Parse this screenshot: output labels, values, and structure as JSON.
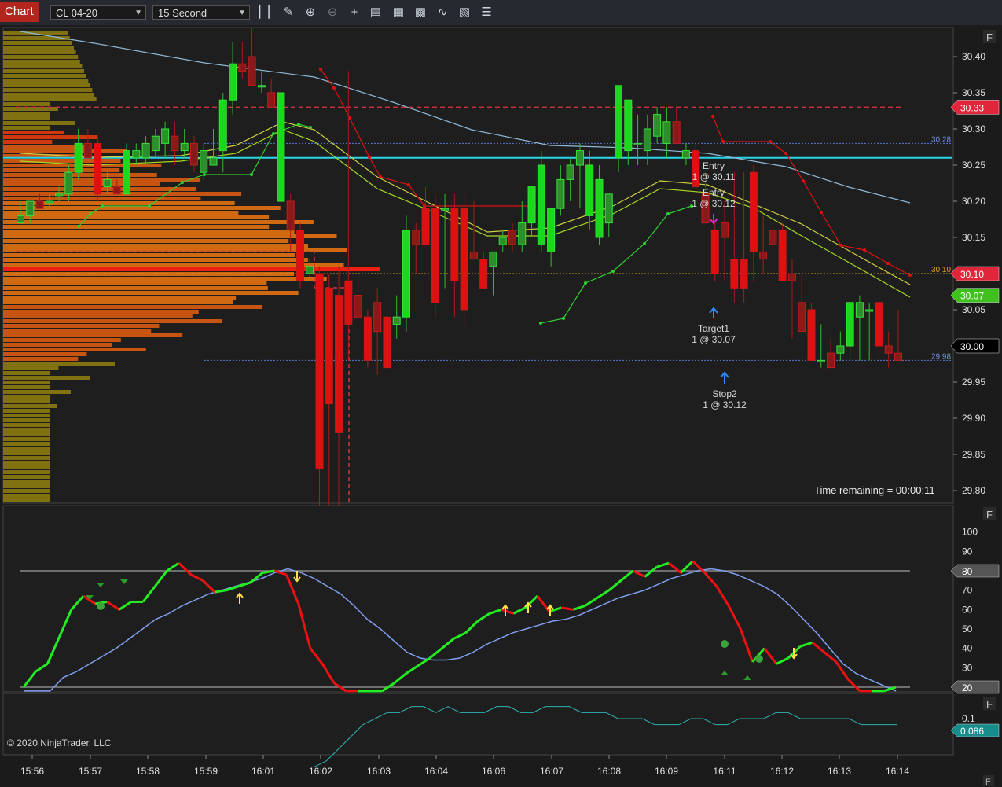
{
  "toolbar": {
    "title": "Chart",
    "instrument": "CL 04-20",
    "interval": "15 Second",
    "icons": [
      "bar-type-icon",
      "draw-tool-icon",
      "zoom-in-icon",
      "zoom-out-icon",
      "crosshair-icon",
      "properties-icon",
      "data-box-icon",
      "indicators-icon",
      "strategies-icon",
      "templates-icon",
      "menu-icon"
    ]
  },
  "chart_data": [
    {
      "type": "candlestick",
      "panel": "price",
      "x_ticks": [
        "15:56",
        "15:57",
        "15:58",
        "15:59",
        "16:01",
        "16:02",
        "16:03",
        "16:04",
        "16:06",
        "16:07",
        "16:08",
        "16:09",
        "16:11",
        "16:12",
        "16:13",
        "16:14"
      ],
      "y_ticks": [
        "30.40",
        "30.35",
        "30.30",
        "30.25",
        "30.20",
        "30.15",
        "30.10",
        "30.05",
        "29.95",
        "29.90",
        "29.85",
        "29.80"
      ],
      "ylim": [
        29.785,
        30.43
      ],
      "candles": [
        [
          30.17,
          30.2,
          30.17,
          30.18
        ],
        [
          30.18,
          30.2,
          30.17,
          30.2
        ],
        [
          30.2,
          30.21,
          30.19,
          30.19
        ],
        [
          30.2,
          30.21,
          30.19,
          30.2
        ],
        [
          30.21,
          30.22,
          30.2,
          30.21
        ],
        [
          30.21,
          30.25,
          30.2,
          30.24
        ],
        [
          30.24,
          30.3,
          30.23,
          30.28
        ],
        [
          30.28,
          30.3,
          30.26,
          30.26
        ],
        [
          30.28,
          30.29,
          30.2,
          30.21
        ],
        [
          30.22,
          30.24,
          30.21,
          30.23
        ],
        [
          30.22,
          30.23,
          30.21,
          30.21
        ],
        [
          30.21,
          30.28,
          30.21,
          30.27
        ],
        [
          30.26,
          30.28,
          30.25,
          30.27
        ],
        [
          30.26,
          30.29,
          30.25,
          30.28
        ],
        [
          30.27,
          30.3,
          30.26,
          30.29
        ],
        [
          30.28,
          30.31,
          30.26,
          30.3
        ],
        [
          30.29,
          30.31,
          30.25,
          30.27
        ],
        [
          30.27,
          30.3,
          30.26,
          30.28
        ],
        [
          30.28,
          30.29,
          30.24,
          30.25
        ],
        [
          30.24,
          30.28,
          30.23,
          30.27
        ],
        [
          30.25,
          30.3,
          30.25,
          30.26
        ],
        [
          30.27,
          30.35,
          30.24,
          30.34
        ],
        [
          30.34,
          30.42,
          30.32,
          30.39
        ],
        [
          30.39,
          30.42,
          30.37,
          30.38
        ],
        [
          30.4,
          30.44,
          30.38,
          30.36
        ],
        [
          30.36,
          30.38,
          30.35,
          30.36
        ],
        [
          30.35,
          30.37,
          30.33,
          30.33
        ],
        [
          30.2,
          30.35,
          30.2,
          30.35
        ],
        [
          30.2,
          30.21,
          30.13,
          30.16
        ],
        [
          30.16,
          30.17,
          30.08,
          30.09
        ],
        [
          30.1,
          30.12,
          30.09,
          30.11
        ],
        [
          30.1,
          30.11,
          29.78,
          29.83
        ],
        [
          30.08,
          30.1,
          29.78,
          29.92
        ],
        [
          30.07,
          30.11,
          29.78,
          29.88
        ],
        [
          30.09,
          30.38,
          29.98,
          30.03
        ],
        [
          30.07,
          30.1,
          30.05,
          30.04
        ],
        [
          30.04,
          30.05,
          29.97,
          29.98
        ],
        [
          30.06,
          30.08,
          29.96,
          30.02
        ],
        [
          30.04,
          30.07,
          29.96,
          29.97
        ],
        [
          30.03,
          30.07,
          30.01,
          30.04
        ],
        [
          30.04,
          30.18,
          30.02,
          30.16
        ],
        [
          30.16,
          30.17,
          30.1,
          30.14
        ],
        [
          30.19,
          30.22,
          30.14,
          30.14
        ],
        [
          30.19,
          30.21,
          30.04,
          30.06
        ],
        [
          30.19,
          30.21,
          30.08,
          30.19
        ],
        [
          30.19,
          30.21,
          30.04,
          30.09
        ],
        [
          30.19,
          30.21,
          30.03,
          30.05
        ],
        [
          30.13,
          30.2,
          30.12,
          30.12
        ],
        [
          30.12,
          30.13,
          30.1,
          30.08
        ],
        [
          30.11,
          30.13,
          30.07,
          30.13
        ],
        [
          30.14,
          30.16,
          30.13,
          30.15
        ],
        [
          30.16,
          30.17,
          30.13,
          30.14
        ],
        [
          30.14,
          30.2,
          30.13,
          30.17
        ],
        [
          30.17,
          30.2,
          30.15,
          30.22
        ],
        [
          30.14,
          30.27,
          30.13,
          30.25
        ],
        [
          30.13,
          30.18,
          30.11,
          30.19
        ],
        [
          30.19,
          30.25,
          30.18,
          30.23
        ],
        [
          30.23,
          30.26,
          30.2,
          30.25
        ],
        [
          30.25,
          30.28,
          30.19,
          30.27
        ],
        [
          30.18,
          30.27,
          30.16,
          30.25
        ],
        [
          30.15,
          30.25,
          30.14,
          30.23
        ],
        [
          30.17,
          30.21,
          30.15,
          30.21
        ],
        [
          30.26,
          30.34,
          30.24,
          30.36
        ],
        [
          30.27,
          30.34,
          30.25,
          30.34
        ],
        [
          30.28,
          30.32,
          30.25,
          30.28
        ],
        [
          30.27,
          30.32,
          30.25,
          30.3
        ],
        [
          30.29,
          30.33,
          30.28,
          30.32
        ],
        [
          30.28,
          30.33,
          30.26,
          30.31
        ],
        [
          30.31,
          30.33,
          30.28,
          30.28
        ],
        [
          30.26,
          30.28,
          30.25,
          30.27
        ],
        [
          30.27,
          30.28,
          30.23,
          30.22
        ],
        [
          30.21,
          30.24,
          30.18,
          30.17
        ],
        [
          30.16,
          30.17,
          30.09,
          30.1
        ],
        [
          30.17,
          30.2,
          30.09,
          30.15
        ],
        [
          30.12,
          30.24,
          30.06,
          30.08
        ],
        [
          30.12,
          30.24,
          30.06,
          30.08
        ],
        [
          30.24,
          30.25,
          30.09,
          30.13
        ],
        [
          30.13,
          30.18,
          30.1,
          30.12
        ],
        [
          30.16,
          30.17,
          30.08,
          30.14
        ],
        [
          30.16,
          30.17,
          30.09,
          30.09
        ],
        [
          30.1,
          30.12,
          30.01,
          30.09
        ],
        [
          30.06,
          30.1,
          30.04,
          30.02
        ],
        [
          30.05,
          30.06,
          29.99,
          29.98
        ],
        [
          29.98,
          30.03,
          29.97,
          29.98
        ],
        [
          29.99,
          30.01,
          29.97,
          29.97
        ],
        [
          29.99,
          30.02,
          29.98,
          30.0
        ],
        [
          30.0,
          30.05,
          29.98,
          30.06
        ],
        [
          30.04,
          30.07,
          29.98,
          30.06
        ],
        [
          30.05,
          30.06,
          29.98,
          30.05
        ],
        [
          30.06,
          30.05,
          29.98,
          30.0
        ],
        [
          30.0,
          30.02,
          29.97,
          29.99
        ],
        [
          29.99,
          30.05,
          29.98,
          29.98
        ]
      ],
      "lines": {
        "horizontal_red_dashed": [
          30.33
        ],
        "cyan_solid": 30.26,
        "blue_dotted": [
          30.28,
          29.98
        ],
        "orange_dotted": 30.1
      },
      "price_labels": [
        {
          "text": "30.33",
          "color": "#e0263a"
        },
        {
          "text": "30.10",
          "color": "#e0263a"
        },
        {
          "text": "30.07",
          "color": "#3ec11c"
        },
        {
          "text": "30.00",
          "color": "#000000"
        }
      ],
      "line_tags": [
        {
          "text": "30.28",
          "color": "#6f8fe0"
        },
        {
          "text": "30.10",
          "color": "#e0a020"
        },
        {
          "text": "29.98",
          "color": "#6f8fe0"
        }
      ],
      "annotations": [
        {
          "text": "Entry",
          "sub": "1 @ 30.11"
        },
        {
          "text": "Entry",
          "sub": "1 @ 30.12"
        },
        {
          "text": "Target1",
          "sub": "1 @ 30.07"
        },
        {
          "text": "Stop2",
          "sub": "1 @ 30.12"
        }
      ],
      "info": "Time remaining = 00:00:11",
      "copyright": "© 2020 NinjaTrader, LLC",
      "panel_button": "F"
    },
    {
      "type": "line",
      "panel": "oscillator",
      "y_ticks": [
        "100",
        "90",
        "70",
        "60",
        "50",
        "40",
        "30"
      ],
      "ylim": [
        18,
        112
      ],
      "levels": [
        {
          "value": 80,
          "label": "80"
        },
        {
          "value": 20,
          "label": "20"
        }
      ],
      "series": [
        {
          "color": "#7f9ff0",
          "values": [
            10,
            12,
            16,
            25,
            28,
            32,
            36,
            40,
            45,
            50,
            55,
            58,
            62,
            65,
            68,
            70,
            72,
            74,
            76,
            79,
            81,
            79,
            76,
            72,
            68,
            62,
            55,
            50,
            44,
            38,
            35,
            34,
            34,
            35,
            38,
            42,
            45,
            48,
            50,
            52,
            54,
            55,
            57,
            60,
            63,
            66,
            68,
            70,
            73,
            76,
            78,
            80,
            81,
            80,
            78,
            75,
            72,
            68,
            62,
            55,
            48,
            40,
            32,
            27,
            24,
            21,
            18
          ]
        },
        {
          "color": "#22ee22",
          "values": [
            20,
            28,
            32,
            46,
            60,
            67,
            63,
            64,
            60,
            64,
            64,
            72,
            80,
            84,
            78,
            75,
            69,
            70,
            72,
            74,
            79,
            80,
            78,
            63,
            40,
            32,
            22,
            15,
            10,
            12,
            15,
            22,
            27,
            31,
            35,
            40,
            45,
            48,
            54,
            58,
            60,
            58,
            61,
            67,
            59,
            61,
            60,
            62,
            66,
            70,
            75,
            80,
            77,
            82,
            84,
            79,
            85,
            79,
            72,
            62,
            50,
            33,
            40,
            32,
            35,
            41,
            43,
            38,
            33,
            24,
            18,
            15,
            18,
            20
          ]
        }
      ],
      "panel_button": "F"
    },
    {
      "type": "line",
      "panel": "bottom",
      "y_ticks": [
        "0.1"
      ],
      "current_label": "0.086",
      "series": [
        {
          "color": "#2fb3b3",
          "values": [
            0.02,
            0.03,
            0.05,
            0.07,
            0.09,
            0.1,
            0.11,
            0.11,
            0.12,
            0.12,
            0.11,
            0.12,
            0.11,
            0.11,
            0.11,
            0.12,
            0.12,
            0.11,
            0.11,
            0.12,
            0.12,
            0.12,
            0.11,
            0.11,
            0.11,
            0.1,
            0.1,
            0.1,
            0.09,
            0.09,
            0.09,
            0.1,
            0.1,
            0.09,
            0.09,
            0.1,
            0.1,
            0.1,
            0.11,
            0.11,
            0.1,
            0.1,
            0.1,
            0.1,
            0.1,
            0.09,
            0.09,
            0.09,
            0.09
          ]
        }
      ],
      "panel_button": "F"
    }
  ]
}
